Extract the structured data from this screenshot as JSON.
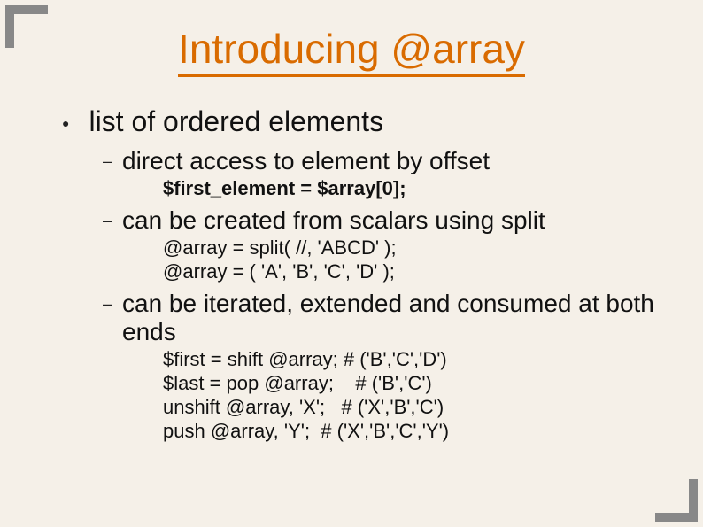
{
  "title": "Introducing @array",
  "bullet1": "list of ordered elements",
  "sub1": {
    "text": "direct access to element by offset",
    "code": [
      "$first_element = $array[0];"
    ]
  },
  "sub2": {
    "text": "can be created from scalars using split",
    "code": [
      "@array = split( //, 'ABCD' );",
      "@array = ( 'A', 'B', 'C', 'D' );"
    ]
  },
  "sub3": {
    "text": "can be iterated, extended and consumed at both ends",
    "code": [
      "$first = shift @array; # ('B','C','D')",
      "$last = pop @array;    # ('B','C')",
      "unshift @array, 'X';   # ('X','B','C')",
      "push @array, 'Y';  # ('X','B','C','Y')"
    ]
  }
}
